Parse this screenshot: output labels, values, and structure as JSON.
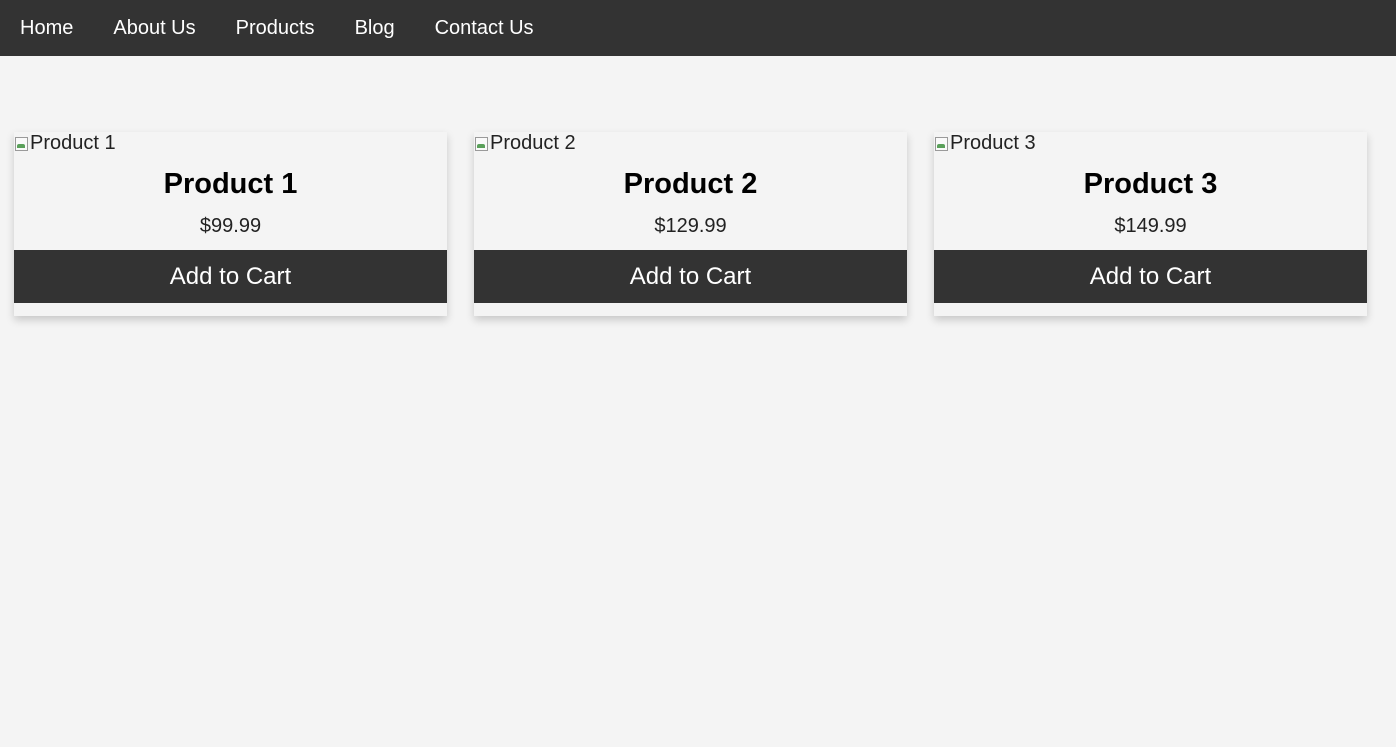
{
  "nav": {
    "items": [
      {
        "label": "Home"
      },
      {
        "label": "About Us"
      },
      {
        "label": "Products"
      },
      {
        "label": "Blog"
      },
      {
        "label": "Contact Us"
      }
    ]
  },
  "products": [
    {
      "image_alt": "Product 1",
      "title": "Product 1",
      "price": "$99.99",
      "button_label": "Add to Cart"
    },
    {
      "image_alt": "Product 2",
      "title": "Product 2",
      "price": "$129.99",
      "button_label": "Add to Cart"
    },
    {
      "image_alt": "Product 3",
      "title": "Product 3",
      "price": "$149.99",
      "button_label": "Add to Cart"
    }
  ],
  "colors": {
    "navbar_bg": "#333333",
    "page_bg": "#f4f4f4",
    "button_bg": "#333333",
    "button_text": "#ffffff"
  }
}
